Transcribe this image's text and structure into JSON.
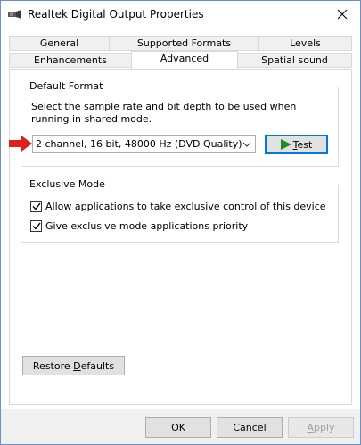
{
  "window": {
    "title": "Realtek Digital Output Properties"
  },
  "tabs": {
    "row1": [
      {
        "label": "General"
      },
      {
        "label": "Supported Formats"
      },
      {
        "label": "Levels"
      }
    ],
    "row2": [
      {
        "label": "Enhancements"
      },
      {
        "label": "Advanced",
        "active": true
      },
      {
        "label": "Spatial sound"
      }
    ]
  },
  "default_format": {
    "title": "Default Format",
    "description": "Select the sample rate and bit depth to be used when running in shared mode.",
    "selected_format": "2 channel, 16 bit, 48000 Hz (DVD Quality)",
    "test_button": {
      "accel": "T",
      "rest": "est"
    }
  },
  "exclusive_mode": {
    "title": "Exclusive Mode",
    "options": [
      {
        "label": "Allow applications to take exclusive control of this device",
        "checked": true
      },
      {
        "label": "Give exclusive mode applications priority",
        "checked": true
      }
    ]
  },
  "restore_button": {
    "pre": "Restore ",
    "accel": "D",
    "rest": "efaults"
  },
  "footer": {
    "ok": "OK",
    "cancel": "Cancel",
    "apply": {
      "accel": "A",
      "rest": "pply",
      "disabled": true
    }
  },
  "colors": {
    "accent": "#0078d7",
    "arrow": "#e0201c",
    "play": "#1f8a1f"
  },
  "icons": {
    "app": "speaker-icon",
    "close": "close-icon",
    "arrow": "red-arrow-icon",
    "test": "play-icon",
    "dropdown": "chevron-down-icon",
    "check": "checkmark-icon"
  }
}
